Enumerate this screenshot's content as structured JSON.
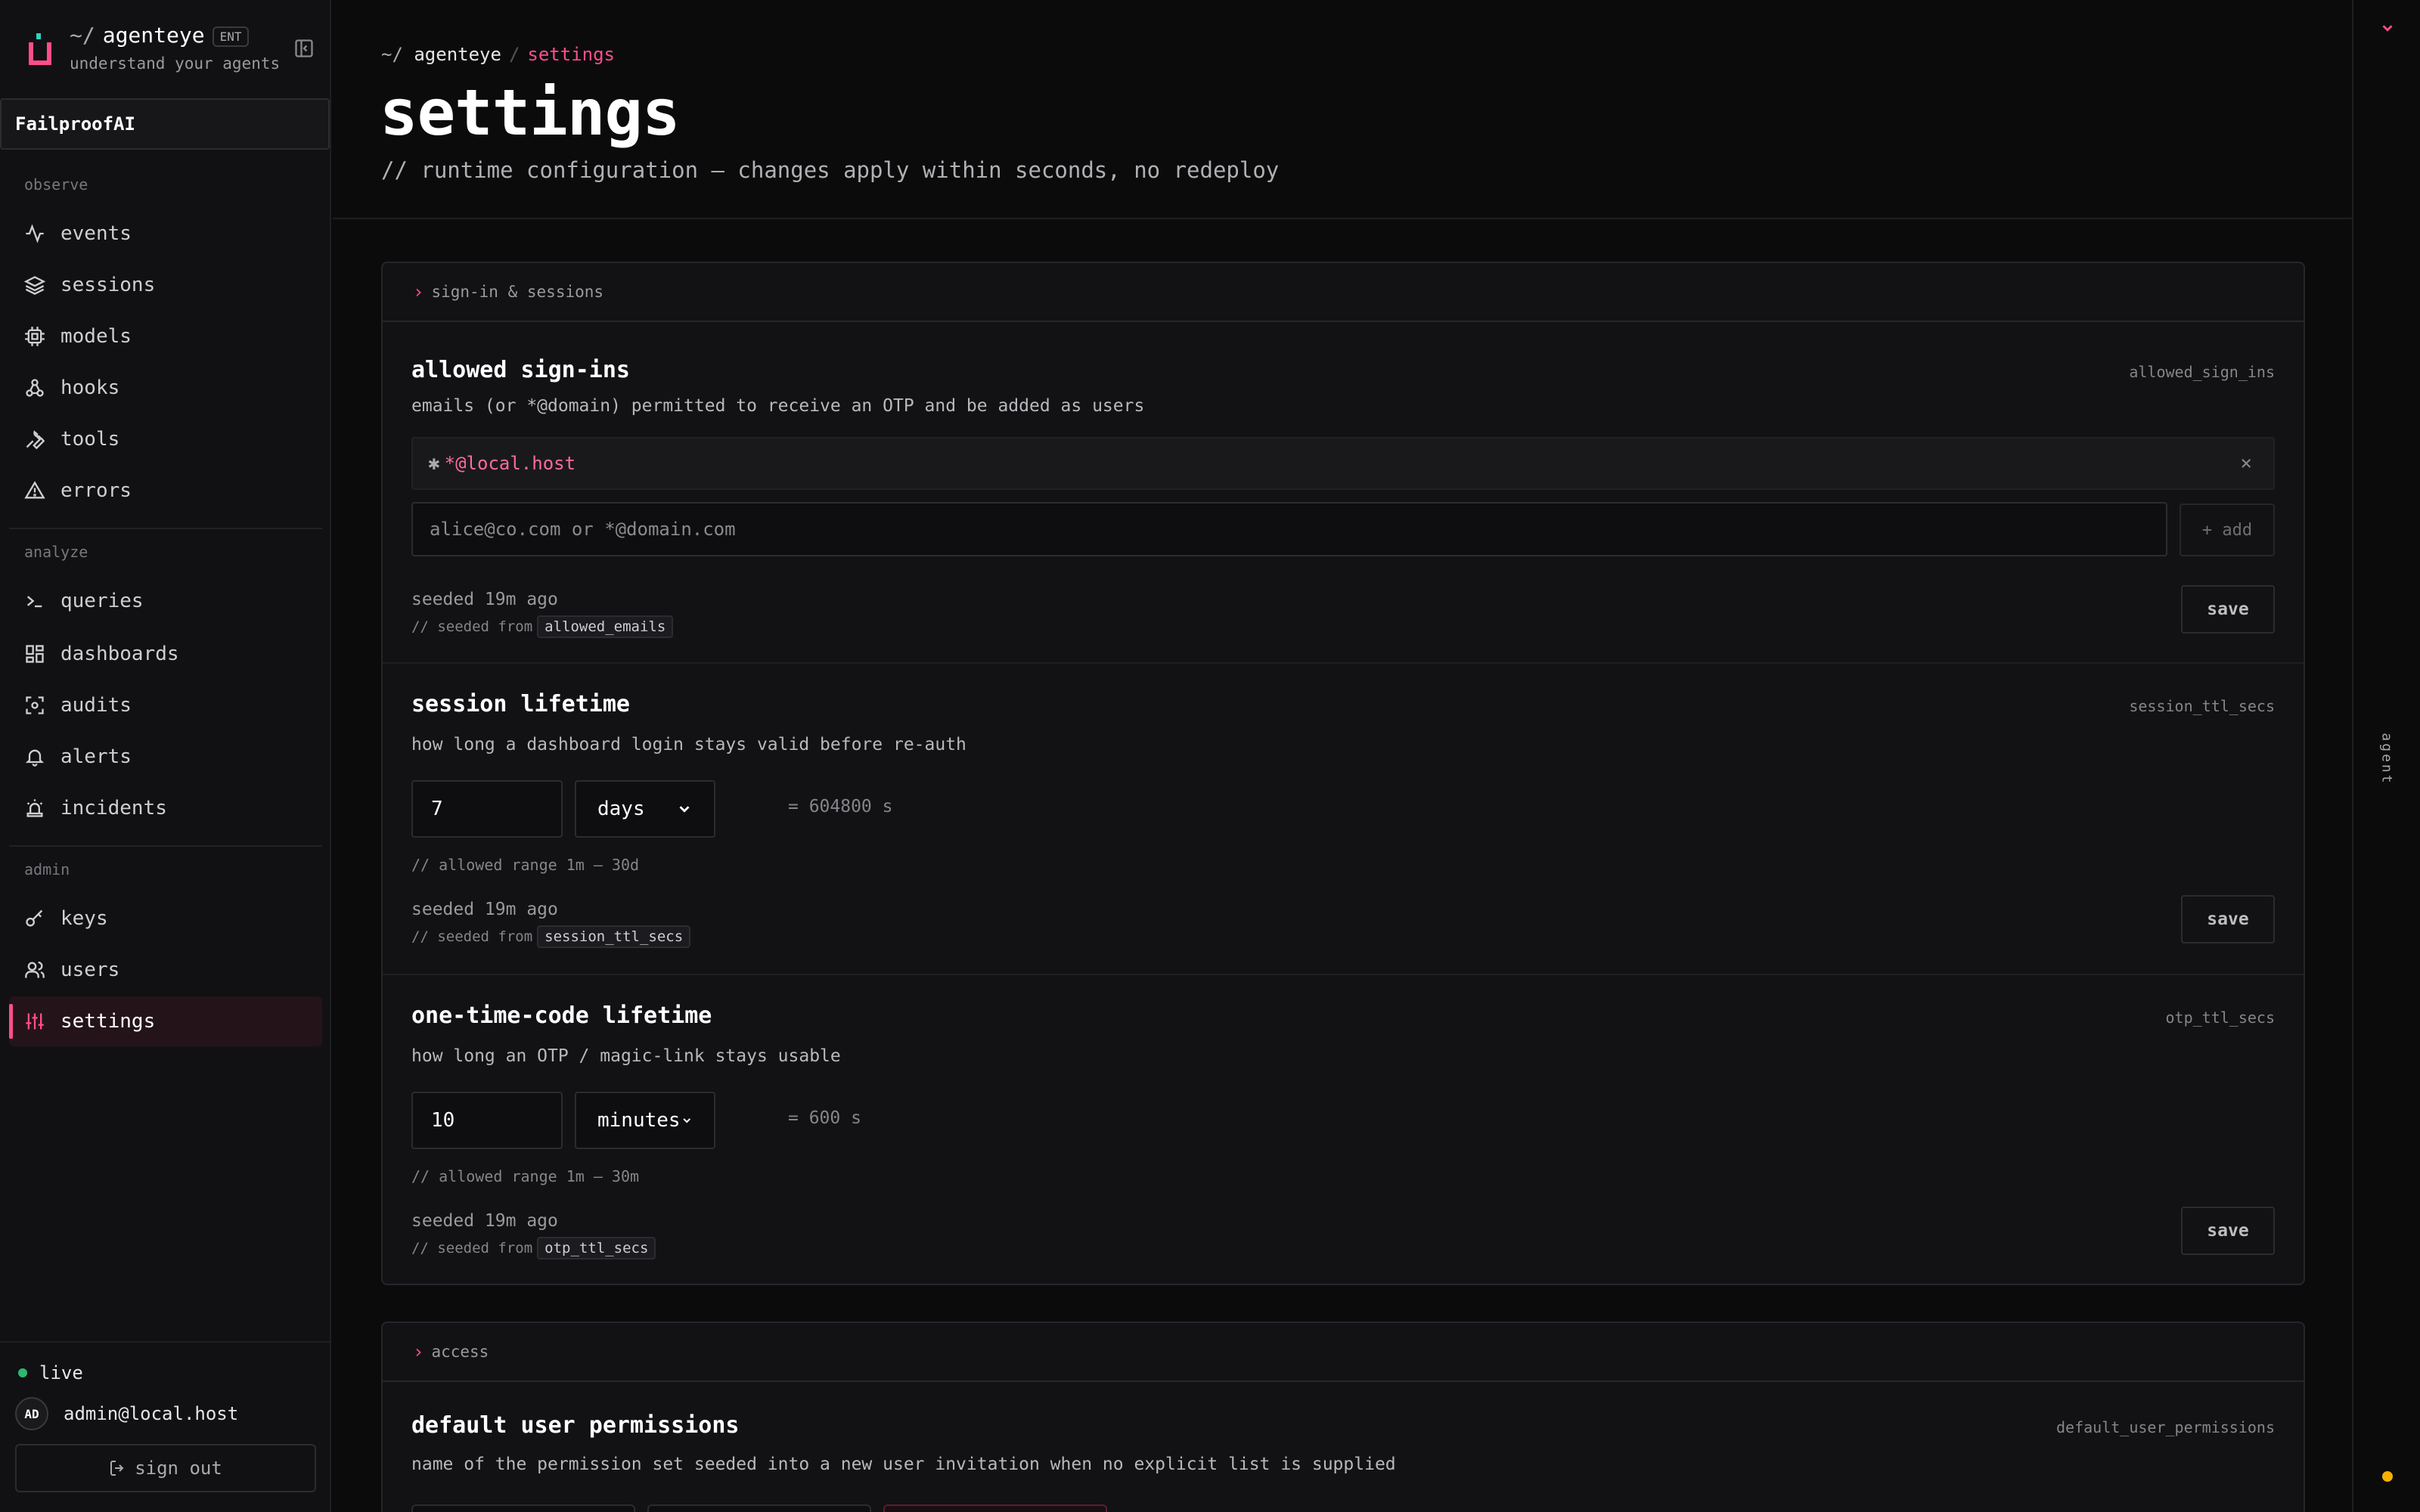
{
  "brand": {
    "prefix": "~/",
    "name": "agenteye",
    "badge": "ENT",
    "tagline": "understand your agents"
  },
  "org": {
    "name": "FailproofAI"
  },
  "nav": {
    "observe_label": "observe",
    "observe": [
      "events",
      "sessions",
      "models",
      "hooks",
      "tools",
      "errors"
    ],
    "analyze_label": "analyze",
    "analyze": [
      "queries",
      "dashboards",
      "audits",
      "alerts",
      "incidents"
    ],
    "admin_label": "admin",
    "admin": [
      "keys",
      "users",
      "settings"
    ]
  },
  "footer": {
    "status": "live",
    "avatar_initials": "AD",
    "user_email": "admin@local.host",
    "signout_label": "sign out"
  },
  "header": {
    "crumb_prefix": "~/",
    "crumb_project": "agenteye",
    "crumb_sep": "/",
    "crumb_current": "settings",
    "title": "settings",
    "subtitle": "// runtime configuration — changes apply within seconds, no redeploy"
  },
  "sections": {
    "signin": {
      "label": "sign-in & sessions",
      "allowed": {
        "title": "allowed sign-ins",
        "key": "allowed_sign_ins",
        "desc": "emails (or *@domain) permitted to receive an OTP and be added as users",
        "entry_icon": "✱",
        "entry": "*@local.host",
        "remove": "×",
        "placeholder": "alice@co.com or *@domain.com",
        "add_label": "+ add",
        "seeded": "seeded 19m ago",
        "seeded_from_prefix": "// seeded from",
        "seeded_from": "allowed_emails",
        "save": "save"
      },
      "session": {
        "title": "session lifetime",
        "key": "session_ttl_secs",
        "desc": "how long a dashboard login stays valid before re-auth",
        "value": "7",
        "unit": "days",
        "equals": "= 604800 s",
        "range": "// allowed range 1m – 30d",
        "seeded": "seeded 19m ago",
        "seeded_from_prefix": "// seeded from",
        "seeded_from": "session_ttl_secs",
        "save": "save"
      },
      "otp": {
        "title": "one-time-code lifetime",
        "key": "otp_ttl_secs",
        "desc": "how long an OTP / magic-link stays usable",
        "value": "10",
        "unit": "minutes",
        "equals": "= 600 s",
        "range": "// allowed range 1m – 30m",
        "seeded": "seeded 19m ago",
        "seeded_from_prefix": "// seeded from",
        "seeded_from": "otp_ttl_secs",
        "save": "save"
      }
    },
    "access": {
      "label": "access",
      "perms": {
        "title": "default user permissions",
        "key": "default_user_permissions",
        "desc": "name of the permission set seeded into a new user invitation when no explicit list is supplied"
      }
    }
  },
  "rail": {
    "label": "agent"
  },
  "colors": {
    "accent": "#ff4d8a",
    "live": "#2eb872",
    "indicator": "#f5b000"
  }
}
